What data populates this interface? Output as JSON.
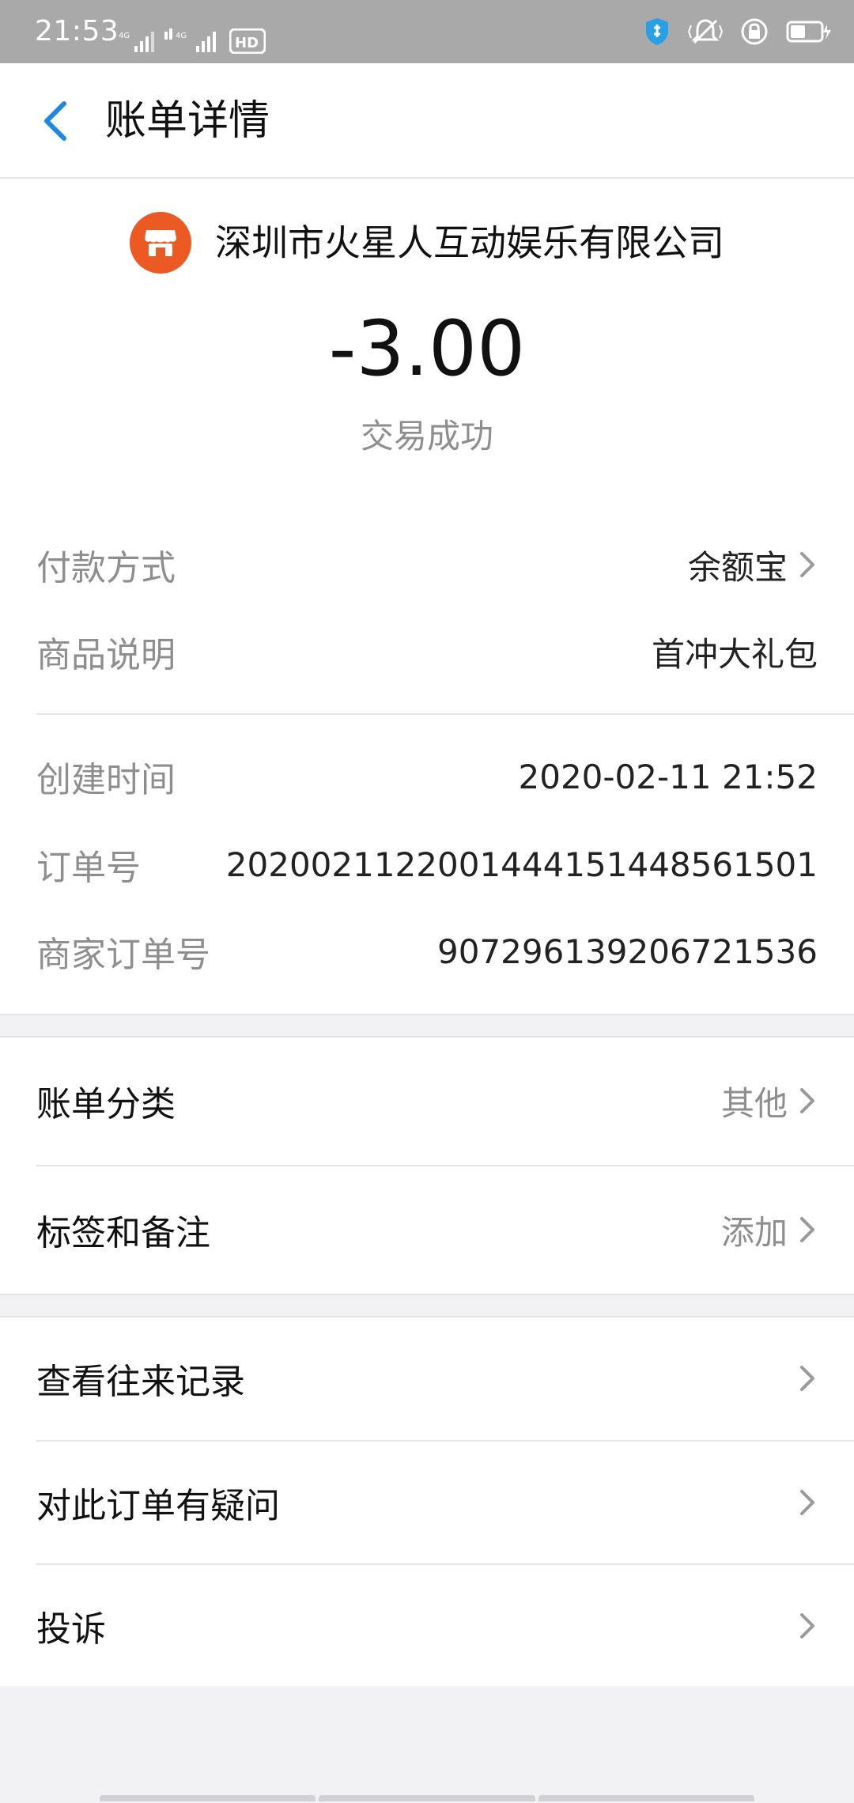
{
  "status_bar": {
    "time": "21:53",
    "network_left": "4G",
    "network_right": "4G",
    "hd_label": "HD"
  },
  "header": {
    "title": "账单详情"
  },
  "summary": {
    "merchant_name": "深圳市火星人互动娱乐有限公司",
    "amount": "-3.00",
    "status": "交易成功"
  },
  "details": {
    "payment_method_label": "付款方式",
    "payment_method_value": "余额宝",
    "product_desc_label": "商品说明",
    "product_desc_value": "首冲大礼包",
    "created_time_label": "创建时间",
    "created_time_value": "2020-02-11 21:52",
    "order_no_label": "订单号",
    "order_no_value": "2020021122001444151448561501",
    "merchant_order_no_label": "商家订单号",
    "merchant_order_no_value": "9072961392067215​36"
  },
  "bill_section": {
    "category_label": "账单分类",
    "category_value": "其他",
    "tag_label": "标签和备注",
    "tag_value": "添加"
  },
  "actions": {
    "history_label": "查看往来记录",
    "question_label": "对此订单有疑问",
    "complaint_label": "投诉"
  },
  "colors": {
    "accent_blue": "#1e88e5",
    "merchant_orange": "#eb5a23",
    "status_bar_gray": "#a9a9a9"
  }
}
